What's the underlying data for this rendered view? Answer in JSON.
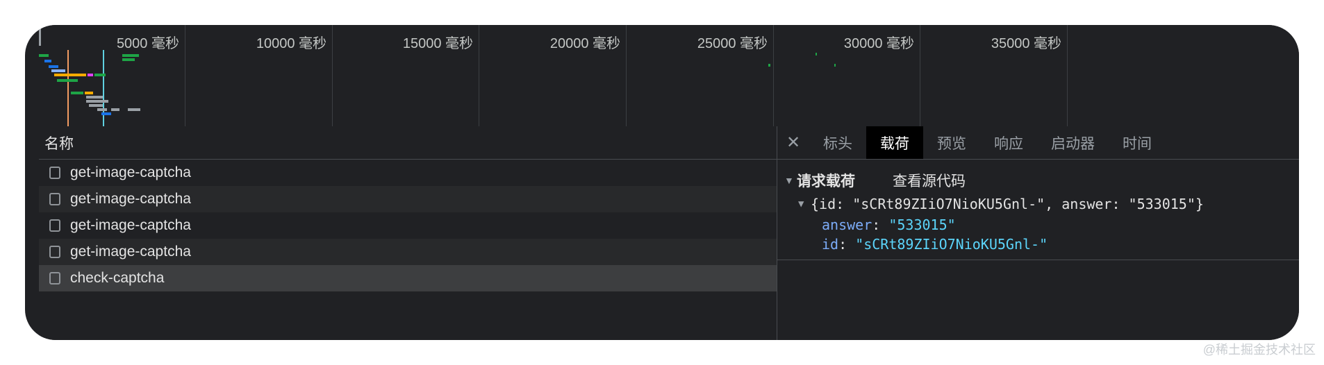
{
  "timeline": {
    "tick_labels": [
      "5000 毫秒",
      "10000 毫秒",
      "15000 毫秒",
      "20000 毫秒",
      "25000 毫秒",
      "30000 毫秒",
      "35000 毫秒"
    ]
  },
  "list": {
    "header": "名称",
    "rows": [
      {
        "name": "get-image-captcha",
        "selected": false
      },
      {
        "name": "get-image-captcha",
        "selected": false
      },
      {
        "name": "get-image-captcha",
        "selected": false
      },
      {
        "name": "get-image-captcha",
        "selected": false
      },
      {
        "name": "check-captcha",
        "selected": true
      }
    ]
  },
  "detail": {
    "close_icon": "close-icon",
    "tabs": [
      {
        "label": "标头",
        "active": false
      },
      {
        "label": "载荷",
        "active": true
      },
      {
        "label": "预览",
        "active": false
      },
      {
        "label": "响应",
        "active": false
      },
      {
        "label": "启动器",
        "active": false
      },
      {
        "label": "时间",
        "active": false
      }
    ],
    "payload": {
      "section_title": "请求载荷",
      "view_source": "查看源代码",
      "object_summary": "{id: \"sCRt89ZIiO7NioKU5Gnl-\", answer: \"533015\"}",
      "props": [
        {
          "key": "answer",
          "value": "\"533015\""
        },
        {
          "key": "id",
          "value": "\"sCRt89ZIiO7NioKU5Gnl-\""
        }
      ]
    }
  },
  "watermark": "@稀土掘金技术社区",
  "colors": {
    "background": "#202124",
    "accent_key": "#7cacf8",
    "accent_value": "#5cd5fb",
    "active_tab": "#000000"
  }
}
